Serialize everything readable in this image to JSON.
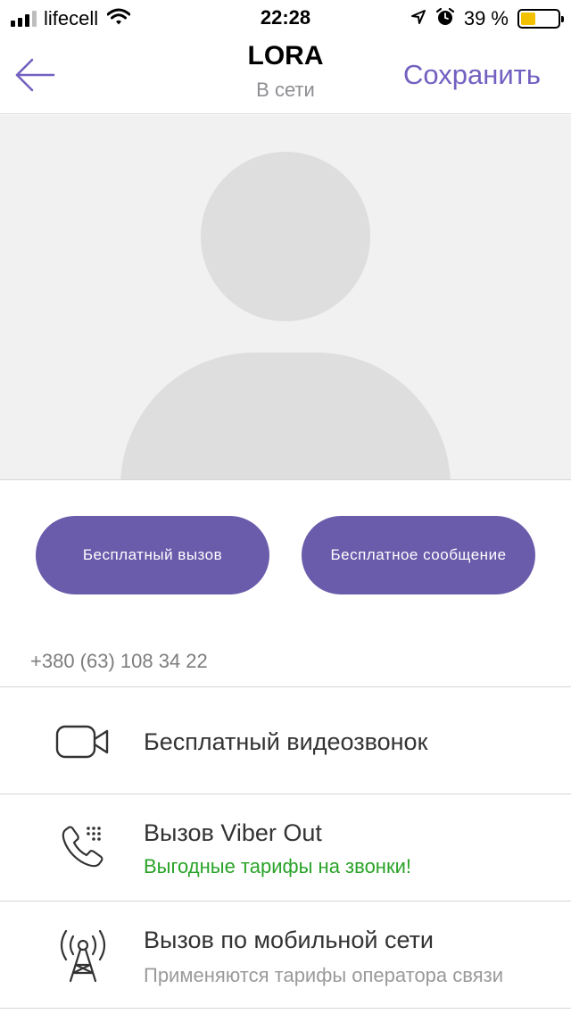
{
  "status_bar": {
    "carrier": "lifecell",
    "time": "22:28",
    "battery_percent": "39 %",
    "battery_level": 0.39,
    "battery_color": "#f2c200",
    "icons": [
      "signal-icon",
      "wifi-icon",
      "location-icon",
      "alarm-icon",
      "battery-icon"
    ]
  },
  "nav": {
    "back_icon": "back-arrow-icon",
    "title": "LORA",
    "subtitle": "В сети",
    "save_label": "Сохранить"
  },
  "profile": {
    "avatar": "default-avatar-placeholder"
  },
  "actions": {
    "free_call_label": "Бесплатный вызов",
    "free_message_label": "Бесплатное сообщение"
  },
  "contact": {
    "phone": "+380 (63) 108 34 22"
  },
  "call_options": [
    {
      "icon": "video-camera-icon",
      "title": "Бесплатный видеозвонок",
      "subtitle": ""
    },
    {
      "icon": "viber-out-phone-icon",
      "title": "Вызов Viber Out",
      "subtitle": "Выгодные тарифы на звонки!"
    },
    {
      "icon": "cell-tower-icon",
      "title": "Вызов по мобильной сети",
      "subtitle": "Применяются тарифы оператора связи"
    }
  ],
  "colors": {
    "accent": "#7360c0",
    "button": "#6a5bab",
    "promo_green": "#2aa329",
    "avatar_bg": "#f1f1f1",
    "avatar_silhouette": "#dedede"
  }
}
